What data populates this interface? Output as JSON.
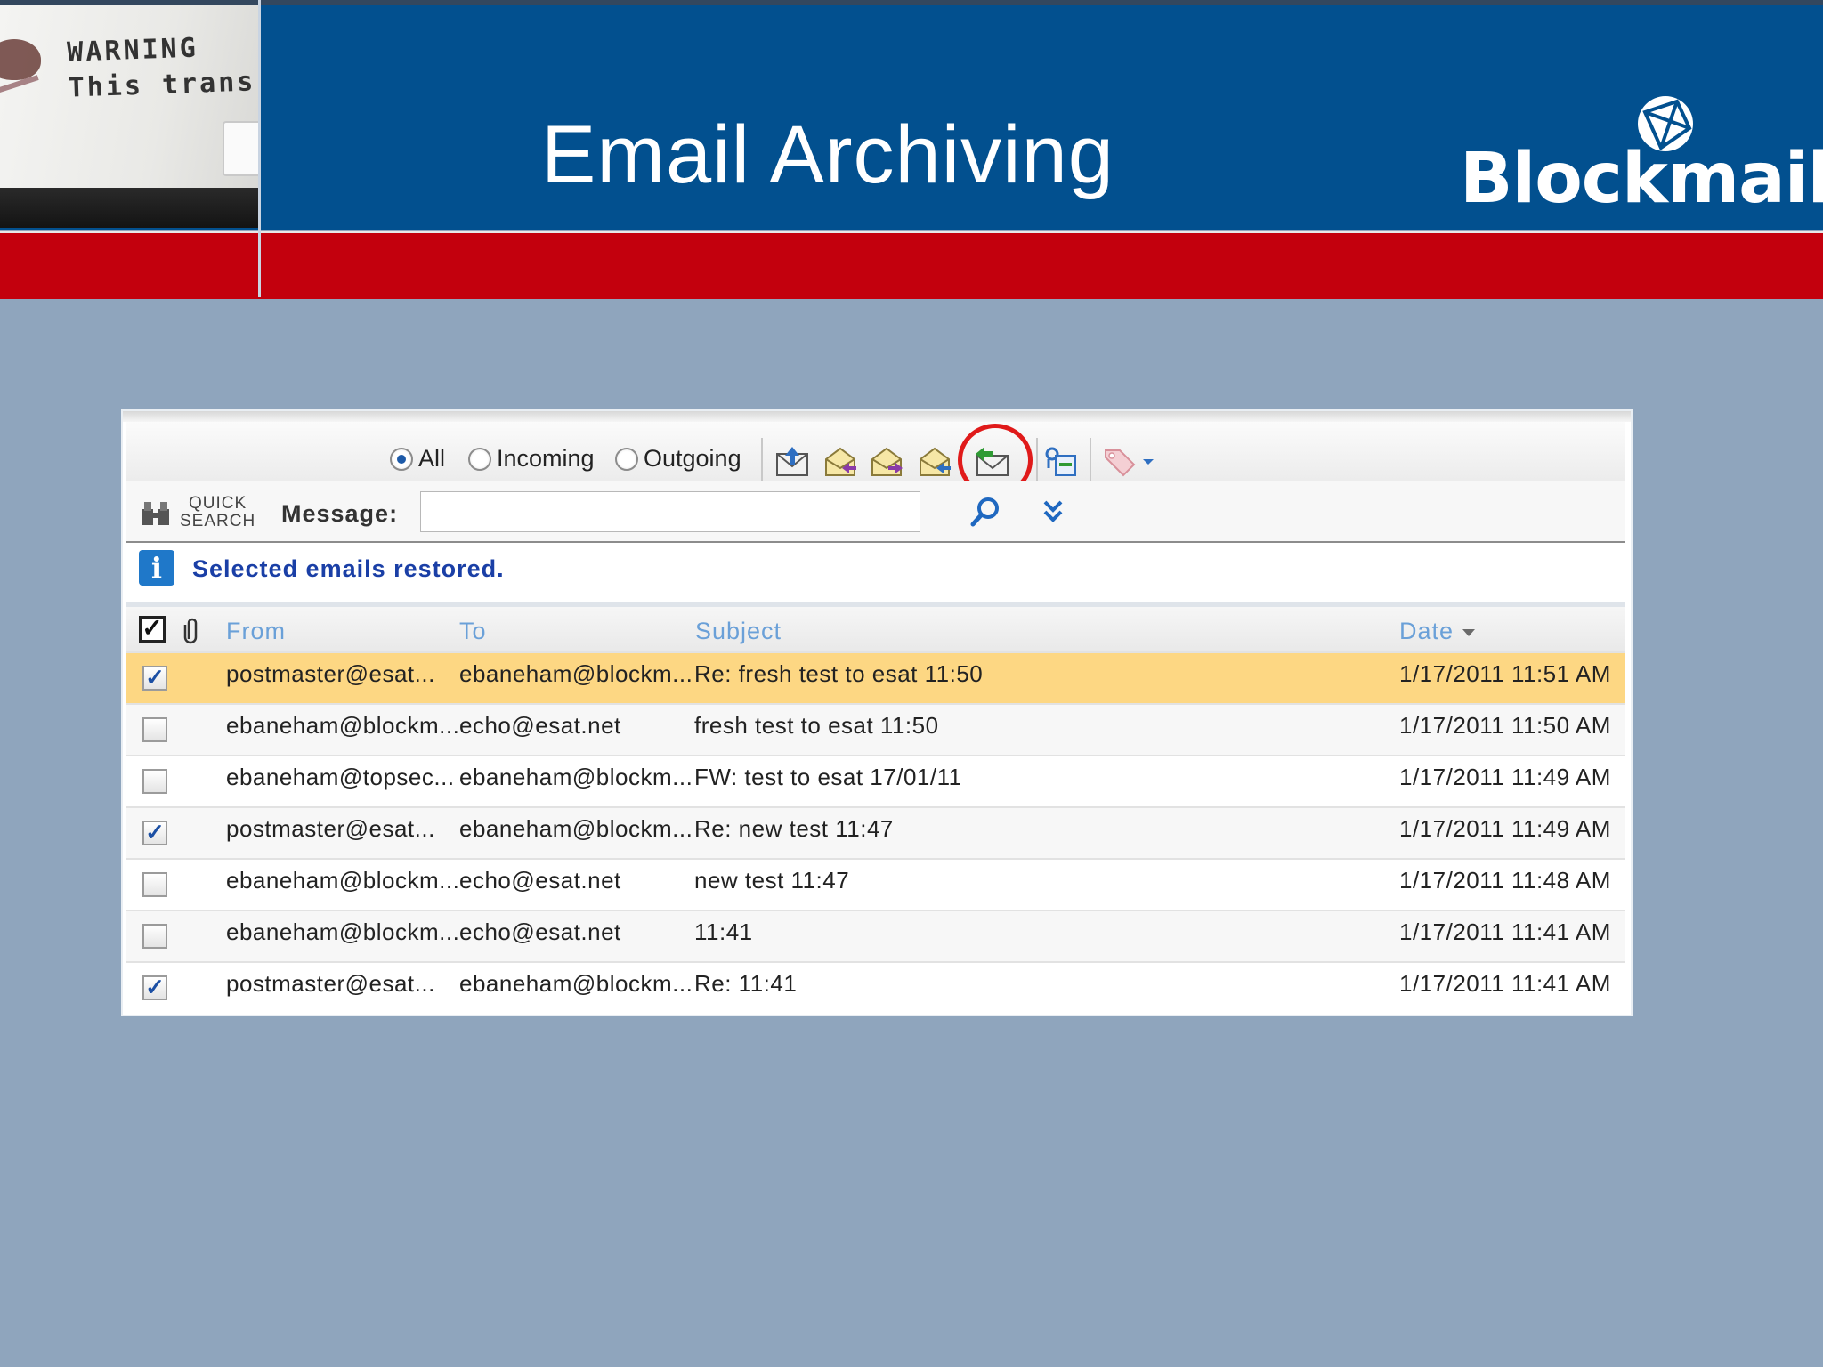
{
  "slide": {
    "title": "Email Archiving",
    "logo_text": "Blockmail",
    "logo_reg": "®",
    "photo_lines": [
      "WARNING",
      "This trans"
    ],
    "colors": {
      "header_blue": "#02508f",
      "band_red": "#c3000d",
      "background": "#8fa5bd"
    }
  },
  "toolbar": {
    "filters": [
      {
        "label": "All",
        "selected": true
      },
      {
        "label": "Incoming",
        "selected": false
      },
      {
        "label": "Outgoing",
        "selected": false
      }
    ],
    "icons": [
      "send-mail-icon",
      "forward-mail-icon",
      "reply-all-mail-icon",
      "redirect-mail-icon",
      "restore-mail-icon",
      "export-icon",
      "tag-icon",
      "tag-dropdown-icon"
    ],
    "highlighted_icon": "restore-mail-icon"
  },
  "search": {
    "quick_search_label_1": "QUICK",
    "quick_search_label_2": "SEARCH",
    "message_label": "Message:",
    "message_value": "",
    "message_placeholder": ""
  },
  "notice": {
    "text": "Selected emails restored."
  },
  "grid": {
    "columns": {
      "from": "From",
      "to": "To",
      "subject": "Subject",
      "date": "Date"
    },
    "rows": [
      {
        "checked": true,
        "from": "postmaster@esat...",
        "to": "ebaneham@blockm...",
        "subject": "Re: fresh test to esat 11:50",
        "date": "1/17/2011 11:51 AM",
        "selected": true
      },
      {
        "checked": false,
        "from": "ebaneham@blockm...",
        "to": "echo@esat.net",
        "subject": "fresh test to esat 11:50",
        "date": "1/17/2011 11:50 AM",
        "selected": false
      },
      {
        "checked": false,
        "from": "ebaneham@topsec...",
        "to": "ebaneham@blockm...",
        "subject": "FW: test to esat 17/01/11",
        "date": "1/17/2011 11:49 AM",
        "selected": false
      },
      {
        "checked": true,
        "from": "postmaster@esat...",
        "to": "ebaneham@blockm...",
        "subject": "Re: new test 11:47",
        "date": "1/17/2011 11:49 AM",
        "selected": false
      },
      {
        "checked": false,
        "from": "ebaneham@blockm...",
        "to": "echo@esat.net",
        "subject": "new test 11:47",
        "date": "1/17/2011 11:48 AM",
        "selected": false
      },
      {
        "checked": false,
        "from": "ebaneham@blockm...",
        "to": "echo@esat.net",
        "subject": "11:41",
        "date": "1/17/2011 11:41 AM",
        "selected": false
      },
      {
        "checked": true,
        "from": "postmaster@esat...",
        "to": "ebaneham@blockm...",
        "subject": "Re: 11:41",
        "date": "1/17/2011 11:41 AM",
        "selected": false
      }
    ]
  }
}
